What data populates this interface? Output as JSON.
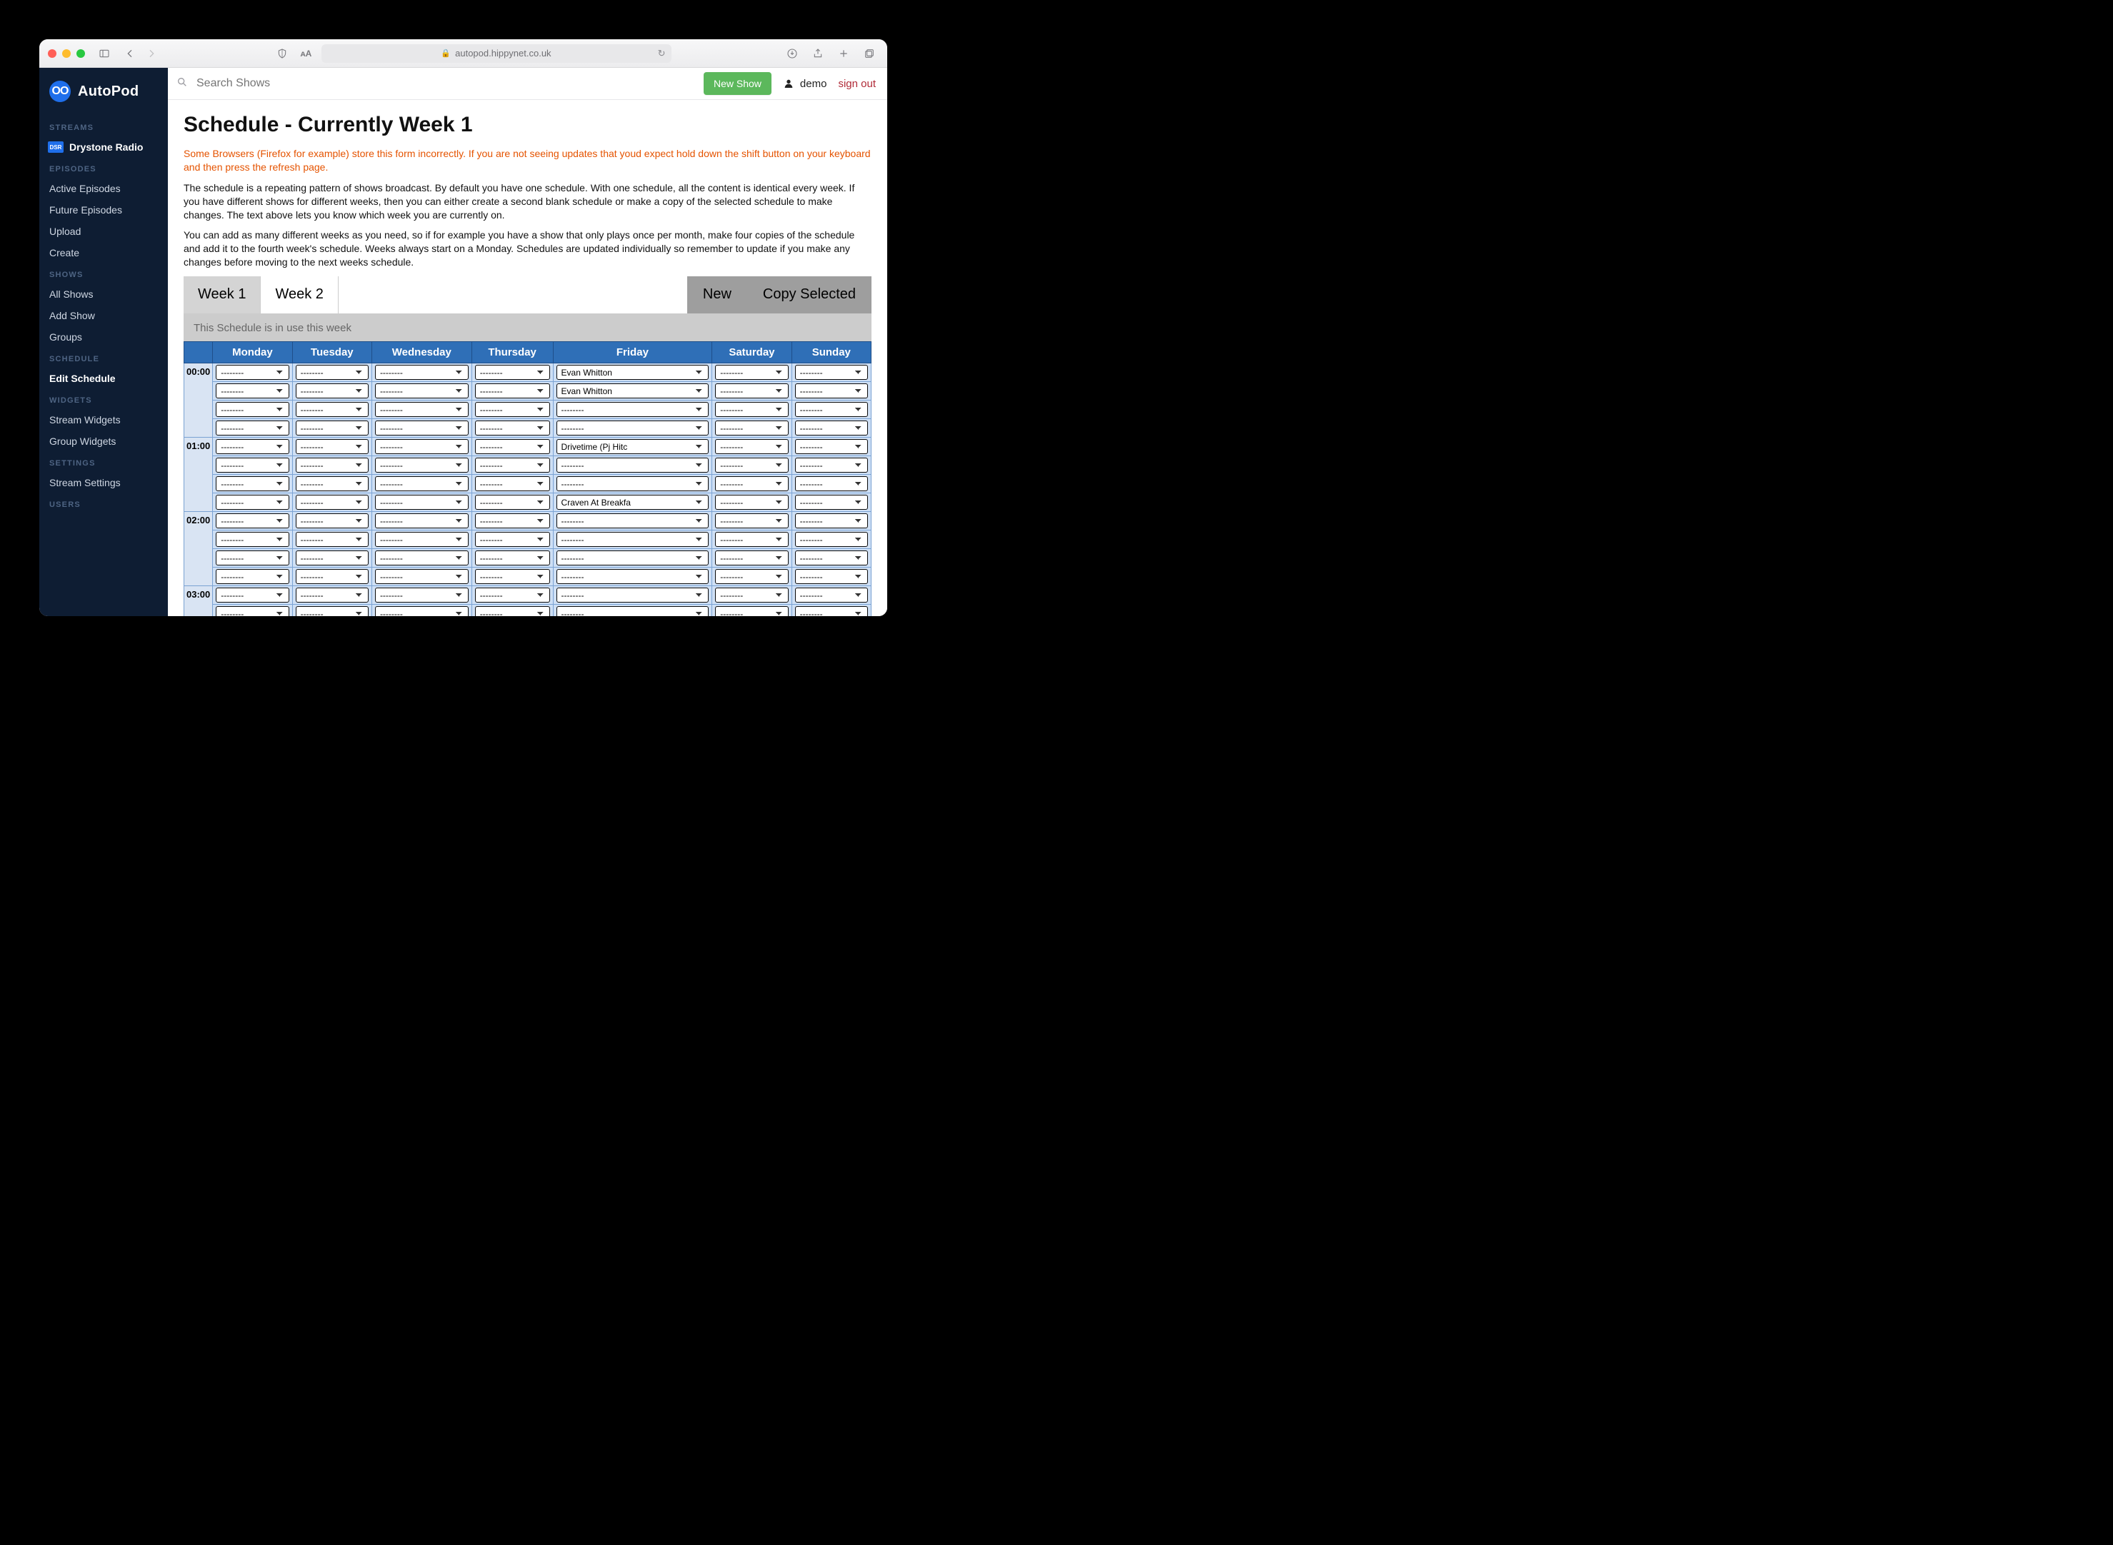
{
  "browser": {
    "url": "autopod.hippynet.co.uk"
  },
  "brand": {
    "name": "AutoPod",
    "glyph": "OO"
  },
  "sidebar": {
    "sections": [
      {
        "label": "STREAMS",
        "items": [
          {
            "label": "Drystone Radio",
            "badge": "DSR",
            "stream": true
          }
        ]
      },
      {
        "label": "EPISODES",
        "items": [
          {
            "label": "Active Episodes"
          },
          {
            "label": "Future Episodes"
          },
          {
            "label": "Upload"
          },
          {
            "label": "Create"
          }
        ]
      },
      {
        "label": "SHOWS",
        "items": [
          {
            "label": "All Shows"
          },
          {
            "label": "Add Show"
          },
          {
            "label": "Groups"
          }
        ]
      },
      {
        "label": "SCHEDULE",
        "items": [
          {
            "label": "Edit Schedule",
            "highlight": true
          }
        ]
      },
      {
        "label": "WIDGETS",
        "items": [
          {
            "label": "Stream Widgets"
          },
          {
            "label": "Group Widgets"
          }
        ]
      },
      {
        "label": "SETTINGS",
        "items": [
          {
            "label": "Stream Settings"
          }
        ]
      },
      {
        "label": "USERS",
        "items": []
      }
    ]
  },
  "topbar": {
    "search_placeholder": "Search Shows",
    "new_show": "New Show",
    "username": "demo",
    "signout": "sign out"
  },
  "page": {
    "title": "Schedule - Currently Week 1",
    "warning": "Some Browsers (Firefox for example) store this form incorrectly. If you are not seeing updates that youd expect hold down the shift button on your keyboard and then press the refresh page.",
    "p1": "The schedule is a repeating pattern of shows broadcast. By default you have one schedule. With one schedule, all the content is identical every week. If you have different shows for different weeks, then you can either create a second blank schedule or make a copy of the selected schedule to make changes. The text above lets you know which week you are currently on.",
    "p2": "You can add as many different weeks as you need, so if for example you have a show that only plays once per month, make four copies of the schedule and add it to the fourth week's schedule. Weeks always start on a Monday. Schedules are updated individually so remember to update if you make any changes before moving to the next weeks schedule."
  },
  "weektabs": {
    "tabs": [
      "Week 1",
      "Week 2"
    ],
    "selected": 0,
    "new": "New",
    "copy": "Copy Selected",
    "note": "This Schedule is in use this week"
  },
  "schedule": {
    "days": [
      "Monday",
      "Tuesday",
      "Wednesday",
      "Thursday",
      "Friday",
      "Saturday",
      "Sunday"
    ],
    "empty": "--------",
    "hours": [
      {
        "time": "00:00",
        "slots": 4,
        "cells": {
          "4": {
            "0": "Evan Whitton",
            "1": "Evan Whitton"
          }
        }
      },
      {
        "time": "01:00",
        "slots": 4,
        "cells": {
          "4": {
            "0": "Drivetime (Pj Hitc",
            "3": "Craven At Breakfa"
          }
        }
      },
      {
        "time": "02:00",
        "slots": 4,
        "cells": {}
      },
      {
        "time": "03:00",
        "slots": 2,
        "cells": {}
      }
    ]
  }
}
